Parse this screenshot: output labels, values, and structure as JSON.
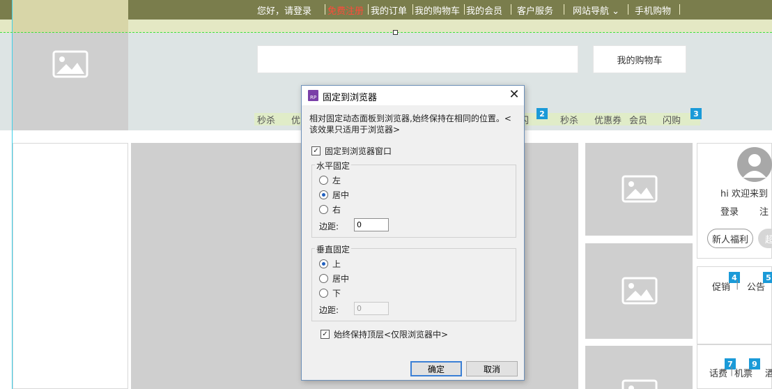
{
  "topnav": {
    "greeting": "您好，请登录",
    "free_register": "免费注册",
    "my_orders": "我的订单",
    "my_cart": "我的购物车",
    "my_member": "我的会员",
    "customer_service": "客户服务",
    "site_nav": "网站导航",
    "site_nav_arrow": "⌄",
    "mobile": "手机购物"
  },
  "header": {
    "cart_button": "我的购物车",
    "search_value": ""
  },
  "nav": {
    "items_left": [
      "秒杀",
      "优"
    ],
    "partial_right_a": "闪",
    "badge_2": "2",
    "items_right": [
      "秒杀",
      "优惠券",
      "会员",
      "闪购"
    ],
    "badge_3": "3"
  },
  "right_panel": {
    "welcome": "hi 欢迎来到",
    "login": "登录",
    "register_partial": "注",
    "new_user_benefit": "新人福利",
    "super_partial": "超",
    "promo": "促销",
    "promo_badge": "4",
    "notice": "公告",
    "notice_badge": "5",
    "phone_bill": "话费",
    "phone_badge": "7",
    "flight": "机票",
    "flight_badge": "9",
    "hotel_partial": "酒"
  },
  "dialog": {
    "title": "固定到浏览器",
    "app_icon_label": "RP",
    "close_glyph": "✕",
    "description": "相对固定动态面板到浏览器,始终保持在相同的位置。< 该效果只适用于浏览器>",
    "pin_checkbox_label": "固定到浏览器窗口",
    "pin_checked": true,
    "horizontal_group": "水平固定",
    "h_options": [
      "左",
      "居中",
      "右"
    ],
    "h_selected": 1,
    "h_margin_label": "边距:",
    "h_margin_value": "0",
    "vertical_group": "垂直固定",
    "v_options": [
      "上",
      "居中",
      "下"
    ],
    "v_selected": 0,
    "v_margin_label": "边距:",
    "v_margin_value": "0",
    "topmost_label": "始终保持顶层<仅限浏览器中>",
    "topmost_checked": true,
    "ok_button": "确定",
    "cancel_button": "取消"
  }
}
